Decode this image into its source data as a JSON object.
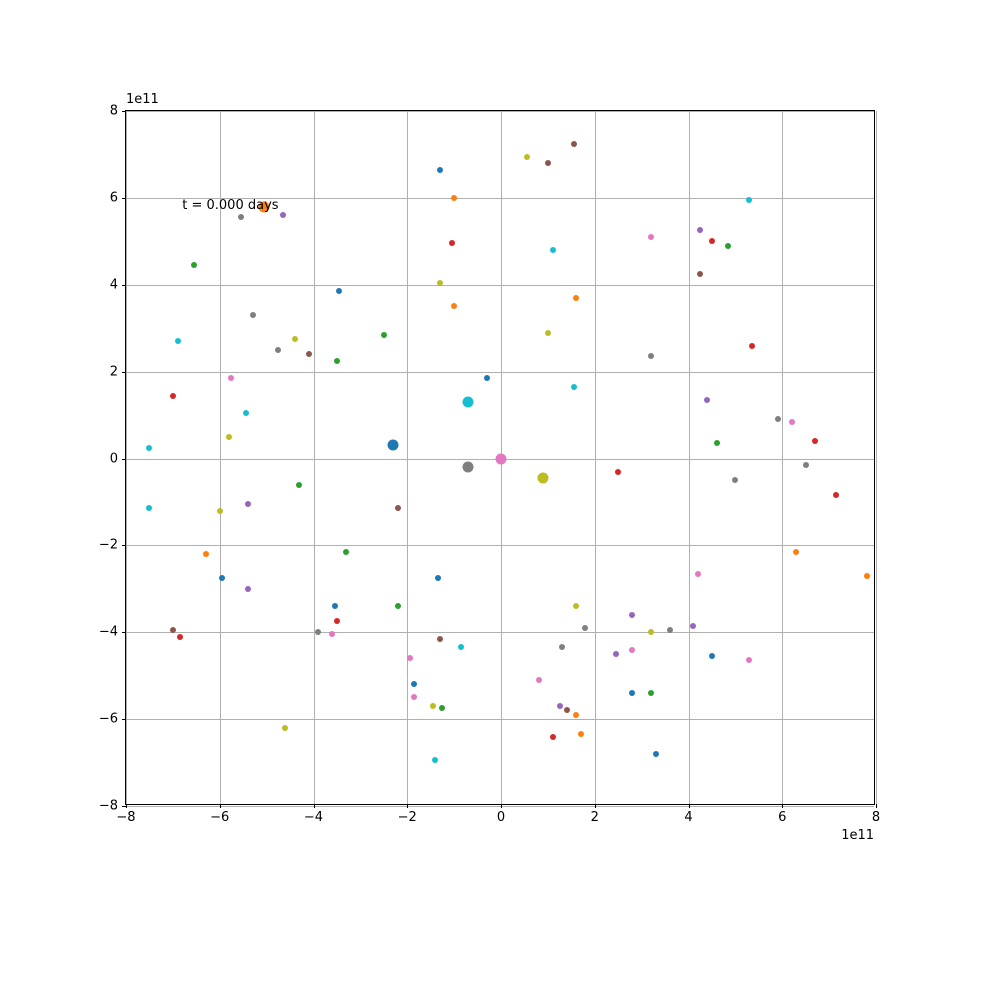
{
  "chart_data": {
    "type": "scatter",
    "title": "",
    "xlabel": "",
    "ylabel": "",
    "annotation": "t = 0.000 days",
    "annotation_pos": {
      "x": -680000000000.0,
      "y": 600000000000.0
    },
    "x_offset_text": "1e11",
    "y_offset_text": "1e11",
    "xlim": [
      -800000000000.0,
      800000000000.0
    ],
    "ylim": [
      -800000000000.0,
      800000000000.0
    ],
    "x_ticks": [
      -800000000000.0,
      -600000000000.0,
      -400000000000.0,
      -200000000000.0,
      0,
      200000000000.0,
      400000000000.0,
      600000000000.0,
      800000000000.0
    ],
    "y_ticks": [
      -800000000000.0,
      -600000000000.0,
      -400000000000.0,
      -200000000000.0,
      0,
      200000000000.0,
      400000000000.0,
      600000000000.0,
      800000000000.0
    ],
    "x_tick_labels": [
      "−8",
      "−6",
      "−4",
      "−2",
      "0",
      "2",
      "4",
      "6",
      "8"
    ],
    "y_tick_labels": [
      "−8",
      "−6",
      "−4",
      "−2",
      "0",
      "2",
      "4",
      "6",
      "8"
    ],
    "grid": true,
    "series": [
      {
        "name": "bodies",
        "points": [
          {
            "x": 0.0,
            "y": 0.0,
            "color": "#e377c2",
            "size": 11
          },
          {
            "x": -70000000000.0,
            "y": -20000000000.0,
            "color": "#7f7f7f",
            "size": 11
          },
          {
            "x": -230000000000.0,
            "y": 30000000000.0,
            "color": "#1f77b4",
            "size": 11
          },
          {
            "x": -70000000000.0,
            "y": 130000000000.0,
            "color": "#17becf",
            "size": 11
          },
          {
            "x": 90000000000.0,
            "y": -45000000000.0,
            "color": "#bcbd22",
            "size": 11
          },
          {
            "x": -505000000000.0,
            "y": 580000000000.0,
            "color": "#ff7f0e",
            "size": 11
          },
          {
            "x": -130000000000.0,
            "y": 665000000000.0,
            "color": "#1f77b4",
            "size": 6
          },
          {
            "x": 55000000000.0,
            "y": 695000000000.0,
            "color": "#bcbd22",
            "size": 6
          },
          {
            "x": 100000000000.0,
            "y": 680000000000.0,
            "color": "#8c564b",
            "size": 6
          },
          {
            "x": 155000000000.0,
            "y": 725000000000.0,
            "color": "#8c564b",
            "size": 6
          },
          {
            "x": -100000000000.0,
            "y": 600000000000.0,
            "color": "#ff7f0e",
            "size": 6
          },
          {
            "x": -555000000000.0,
            "y": 555000000000.0,
            "color": "#7f7f7f",
            "size": 6
          },
          {
            "x": -465000000000.0,
            "y": 560000000000.0,
            "color": "#9467bd",
            "size": 6
          },
          {
            "x": 530000000000.0,
            "y": 595000000000.0,
            "color": "#17becf",
            "size": 6
          },
          {
            "x": -105000000000.0,
            "y": 495000000000.0,
            "color": "#d62728",
            "size": 6
          },
          {
            "x": 110000000000.0,
            "y": 480000000000.0,
            "color": "#17becf",
            "size": 6
          },
          {
            "x": 320000000000.0,
            "y": 510000000000.0,
            "color": "#e377c2",
            "size": 6
          },
          {
            "x": 425000000000.0,
            "y": 525000000000.0,
            "color": "#9467bd",
            "size": 6
          },
          {
            "x": 450000000000.0,
            "y": 500000000000.0,
            "color": "#d62728",
            "size": 6
          },
          {
            "x": 485000000000.0,
            "y": 490000000000.0,
            "color": "#2ca02c",
            "size": 6
          },
          {
            "x": -655000000000.0,
            "y": 445000000000.0,
            "color": "#2ca02c",
            "size": 6
          },
          {
            "x": -130000000000.0,
            "y": 405000000000.0,
            "color": "#bcbd22",
            "size": 6
          },
          {
            "x": 425000000000.0,
            "y": 425000000000.0,
            "color": "#8c564b",
            "size": 6
          },
          {
            "x": -345000000000.0,
            "y": 385000000000.0,
            "color": "#1f77b4",
            "size": 6
          },
          {
            "x": 160000000000.0,
            "y": 370000000000.0,
            "color": "#ff7f0e",
            "size": 6
          },
          {
            "x": -100000000000.0,
            "y": 350000000000.0,
            "color": "#ff7f0e",
            "size": 6
          },
          {
            "x": -530000000000.0,
            "y": 330000000000.0,
            "color": "#7f7f7f",
            "size": 6
          },
          {
            "x": -250000000000.0,
            "y": 285000000000.0,
            "color": "#2ca02c",
            "size": 6
          },
          {
            "x": -440000000000.0,
            "y": 275000000000.0,
            "color": "#bcbd22",
            "size": 6
          },
          {
            "x": -410000000000.0,
            "y": 240000000000.0,
            "color": "#8c564b",
            "size": 6
          },
          {
            "x": -475000000000.0,
            "y": 250000000000.0,
            "color": "#7f7f7f",
            "size": 6
          },
          {
            "x": -690000000000.0,
            "y": 270000000000.0,
            "color": "#17becf",
            "size": 6
          },
          {
            "x": -350000000000.0,
            "y": 225000000000.0,
            "color": "#2ca02c",
            "size": 6
          },
          {
            "x": 100000000000.0,
            "y": 290000000000.0,
            "color": "#bcbd22",
            "size": 6
          },
          {
            "x": 320000000000.0,
            "y": 235000000000.0,
            "color": "#7f7f7f",
            "size": 6
          },
          {
            "x": 535000000000.0,
            "y": 260000000000.0,
            "color": "#d62728",
            "size": 6
          },
          {
            "x": -30000000000.0,
            "y": 185000000000.0,
            "color": "#1f77b4",
            "size": 6
          },
          {
            "x": 155000000000.0,
            "y": 165000000000.0,
            "color": "#17becf",
            "size": 6
          },
          {
            "x": -575000000000.0,
            "y": 185000000000.0,
            "color": "#e377c2",
            "size": 6
          },
          {
            "x": -700000000000.0,
            "y": 145000000000.0,
            "color": "#d62728",
            "size": 6
          },
          {
            "x": -545000000000.0,
            "y": 105000000000.0,
            "color": "#17becf",
            "size": 6
          },
          {
            "x": 440000000000.0,
            "y": 135000000000.0,
            "color": "#9467bd",
            "size": 6
          },
          {
            "x": 590000000000.0,
            "y": 90000000000.0,
            "color": "#7f7f7f",
            "size": 6
          },
          {
            "x": 620000000000.0,
            "y": 85000000000.0,
            "color": "#e377c2",
            "size": 6
          },
          {
            "x": -580000000000.0,
            "y": 50000000000.0,
            "color": "#bcbd22",
            "size": 6
          },
          {
            "x": 460000000000.0,
            "y": 35000000000.0,
            "color": "#2ca02c",
            "size": 6
          },
          {
            "x": 670000000000.0,
            "y": 40000000000.0,
            "color": "#d62728",
            "size": 6
          },
          {
            "x": -750000000000.0,
            "y": 25000000000.0,
            "color": "#17becf",
            "size": 6
          },
          {
            "x": 250000000000.0,
            "y": -30000000000.0,
            "color": "#d62728",
            "size": 6
          },
          {
            "x": 500000000000.0,
            "y": -50000000000.0,
            "color": "#7f7f7f",
            "size": 6
          },
          {
            "x": 650000000000.0,
            "y": -15000000000.0,
            "color": "#7f7f7f",
            "size": 6
          },
          {
            "x": -430000000000.0,
            "y": -60000000000.0,
            "color": "#2ca02c",
            "size": 6
          },
          {
            "x": 715000000000.0,
            "y": -85000000000.0,
            "color": "#d62728",
            "size": 6
          },
          {
            "x": -540000000000.0,
            "y": -105000000000.0,
            "color": "#9467bd",
            "size": 6
          },
          {
            "x": -750000000000.0,
            "y": -115000000000.0,
            "color": "#17becf",
            "size": 6
          },
          {
            "x": -220000000000.0,
            "y": -115000000000.0,
            "color": "#8c564b",
            "size": 6
          },
          {
            "x": -600000000000.0,
            "y": -120000000000.0,
            "color": "#bcbd22",
            "size": 6
          },
          {
            "x": -630000000000.0,
            "y": -220000000000.0,
            "color": "#ff7f0e",
            "size": 6
          },
          {
            "x": -330000000000.0,
            "y": -215000000000.0,
            "color": "#2ca02c",
            "size": 6
          },
          {
            "x": 630000000000.0,
            "y": -215000000000.0,
            "color": "#ff7f0e",
            "size": 6
          },
          {
            "x": 420000000000.0,
            "y": -265000000000.0,
            "color": "#e377c2",
            "size": 6
          },
          {
            "x": -595000000000.0,
            "y": -275000000000.0,
            "color": "#1f77b4",
            "size": 6
          },
          {
            "x": -135000000000.0,
            "y": -275000000000.0,
            "color": "#1f77b4",
            "size": 6
          },
          {
            "x": 780000000000.0,
            "y": -270000000000.0,
            "color": "#ff7f0e",
            "size": 6
          },
          {
            "x": -540000000000.0,
            "y": -300000000000.0,
            "color": "#9467bd",
            "size": 6
          },
          {
            "x": -355000000000.0,
            "y": -340000000000.0,
            "color": "#1f77b4",
            "size": 6
          },
          {
            "x": -220000000000.0,
            "y": -340000000000.0,
            "color": "#2ca02c",
            "size": 6
          },
          {
            "x": 160000000000.0,
            "y": -340000000000.0,
            "color": "#bcbd22",
            "size": 6
          },
          {
            "x": 280000000000.0,
            "y": -360000000000.0,
            "color": "#9467bd",
            "size": 6
          },
          {
            "x": -350000000000.0,
            "y": -375000000000.0,
            "color": "#d62728",
            "size": 6
          },
          {
            "x": -360000000000.0,
            "y": -405000000000.0,
            "color": "#e377c2",
            "size": 6
          },
          {
            "x": -390000000000.0,
            "y": -400000000000.0,
            "color": "#7f7f7f",
            "size": 6
          },
          {
            "x": 180000000000.0,
            "y": -390000000000.0,
            "color": "#7f7f7f",
            "size": 6
          },
          {
            "x": 360000000000.0,
            "y": -395000000000.0,
            "color": "#7f7f7f",
            "size": 6
          },
          {
            "x": 410000000000.0,
            "y": -385000000000.0,
            "color": "#9467bd",
            "size": 6
          },
          {
            "x": 320000000000.0,
            "y": -400000000000.0,
            "color": "#bcbd22",
            "size": 6
          },
          {
            "x": -700000000000.0,
            "y": -395000000000.0,
            "color": "#8c564b",
            "size": 6
          },
          {
            "x": -685000000000.0,
            "y": -410000000000.0,
            "color": "#d62728",
            "size": 6
          },
          {
            "x": -130000000000.0,
            "y": -415000000000.0,
            "color": "#8c564b",
            "size": 6
          },
          {
            "x": 130000000000.0,
            "y": -435000000000.0,
            "color": "#7f7f7f",
            "size": 6
          },
          {
            "x": 280000000000.0,
            "y": -440000000000.0,
            "color": "#e377c2",
            "size": 6
          },
          {
            "x": -85000000000.0,
            "y": -435000000000.0,
            "color": "#17becf",
            "size": 6
          },
          {
            "x": 245000000000.0,
            "y": -450000000000.0,
            "color": "#9467bd",
            "size": 6
          },
          {
            "x": 450000000000.0,
            "y": -455000000000.0,
            "color": "#1f77b4",
            "size": 6
          },
          {
            "x": -195000000000.0,
            "y": -460000000000.0,
            "color": "#e377c2",
            "size": 6
          },
          {
            "x": 530000000000.0,
            "y": -465000000000.0,
            "color": "#e377c2",
            "size": 6
          },
          {
            "x": 80000000000.0,
            "y": -510000000000.0,
            "color": "#e377c2",
            "size": 6
          },
          {
            "x": -185000000000.0,
            "y": -520000000000.0,
            "color": "#1f77b4",
            "size": 6
          },
          {
            "x": 280000000000.0,
            "y": -540000000000.0,
            "color": "#1f77b4",
            "size": 6
          },
          {
            "x": 320000000000.0,
            "y": -540000000000.0,
            "color": "#2ca02c",
            "size": 6
          },
          {
            "x": -185000000000.0,
            "y": -550000000000.0,
            "color": "#e377c2",
            "size": 6
          },
          {
            "x": -145000000000.0,
            "y": -570000000000.0,
            "color": "#bcbd22",
            "size": 6
          },
          {
            "x": -125000000000.0,
            "y": -575000000000.0,
            "color": "#2ca02c",
            "size": 6
          },
          {
            "x": 125000000000.0,
            "y": -570000000000.0,
            "color": "#9467bd",
            "size": 6
          },
          {
            "x": 140000000000.0,
            "y": -580000000000.0,
            "color": "#8c564b",
            "size": 6
          },
          {
            "x": 160000000000.0,
            "y": -590000000000.0,
            "color": "#ff7f0e",
            "size": 6
          },
          {
            "x": -460000000000.0,
            "y": -620000000000.0,
            "color": "#bcbd22",
            "size": 6
          },
          {
            "x": 110000000000.0,
            "y": -640000000000.0,
            "color": "#d62728",
            "size": 6
          },
          {
            "x": 170000000000.0,
            "y": -635000000000.0,
            "color": "#ff7f0e",
            "size": 6
          },
          {
            "x": 330000000000.0,
            "y": -680000000000.0,
            "color": "#1f77b4",
            "size": 6
          },
          {
            "x": -140000000000.0,
            "y": -695000000000.0,
            "color": "#17becf",
            "size": 6
          }
        ]
      }
    ]
  }
}
